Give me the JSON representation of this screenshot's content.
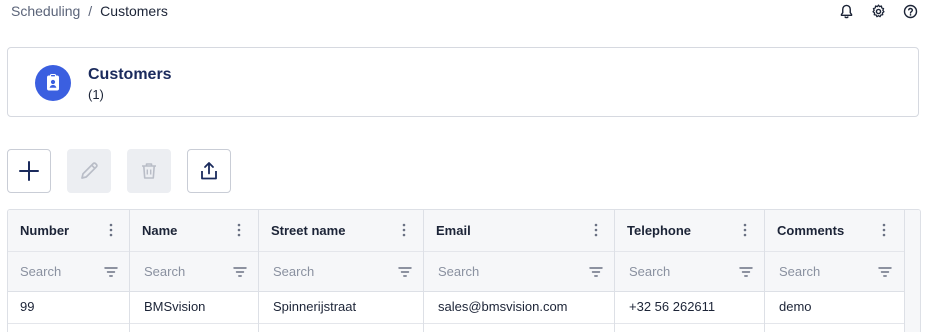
{
  "breadcrumb": {
    "parent": "Scheduling",
    "separator": "/",
    "current": "Customers"
  },
  "top_icons": [
    "bell-icon",
    "gear-icon",
    "help-icon"
  ],
  "header": {
    "title": "Customers",
    "count": "(1)",
    "icon": "customer-card-icon",
    "accent_color": "#3b5fe0"
  },
  "toolbar": {
    "buttons": [
      {
        "icon": "plus-icon",
        "enabled": true
      },
      {
        "icon": "pencil-icon",
        "enabled": false
      },
      {
        "icon": "trash-icon",
        "enabled": false
      },
      {
        "icon": "share-icon",
        "enabled": true
      }
    ]
  },
  "table": {
    "columns": [
      {
        "title": "Number",
        "filter_placeholder": "Search"
      },
      {
        "title": "Name",
        "filter_placeholder": "Search"
      },
      {
        "title": "Street name",
        "filter_placeholder": "Search"
      },
      {
        "title": "Email",
        "filter_placeholder": "Search"
      },
      {
        "title": "Telephone",
        "filter_placeholder": "Search"
      },
      {
        "title": "Comments",
        "filter_placeholder": "Search"
      }
    ],
    "rows": [
      [
        "99",
        "BMSvision",
        "Spinnerijstraat",
        "sales@bmsvision.com",
        "+32 56 262611",
        "demo"
      ]
    ]
  }
}
